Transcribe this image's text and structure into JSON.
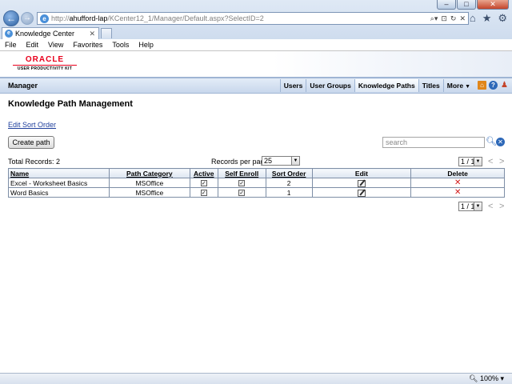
{
  "browser": {
    "url_prefix": "http://",
    "url_host": "ahufford-lap",
    "url_path": "/KCenter12_1/Manager/Default.aspx?SelectID=2",
    "tab_title": "Knowledge Center",
    "menu": [
      "File",
      "Edit",
      "View",
      "Favorites",
      "Tools",
      "Help"
    ],
    "zoom": "100%"
  },
  "logo": {
    "brand": "ORACLE",
    "product": "USER PRODUCTIVITY KIT"
  },
  "manager": {
    "title": "Manager",
    "nav": [
      {
        "label": "Users",
        "active": false
      },
      {
        "label": "User Groups",
        "active": false
      },
      {
        "label": "Knowledge Paths",
        "active": true
      },
      {
        "label": "Titles",
        "active": false
      },
      {
        "label": "More",
        "active": false
      }
    ]
  },
  "page": {
    "title": "Knowledge Path Management",
    "edit_sort_link": "Edit Sort Order",
    "create_button": "Create path",
    "search_placeholder": "search",
    "total_records": "Total Records: 2",
    "records_per_page_label": "Records per page:",
    "records_per_page_value": "25",
    "pager_value": "1 / 1"
  },
  "table": {
    "headers": [
      "Name",
      "Path Category",
      "Active",
      "Self Enroll",
      "Sort Order",
      "Edit",
      "Delete"
    ],
    "rows": [
      {
        "name": "Excel - Worksheet Basics",
        "category": "MSOffice",
        "active": true,
        "self_enroll": true,
        "sort_order": "2"
      },
      {
        "name": "Word Basics",
        "category": "MSOffice",
        "active": true,
        "self_enroll": true,
        "sort_order": "1"
      }
    ]
  }
}
